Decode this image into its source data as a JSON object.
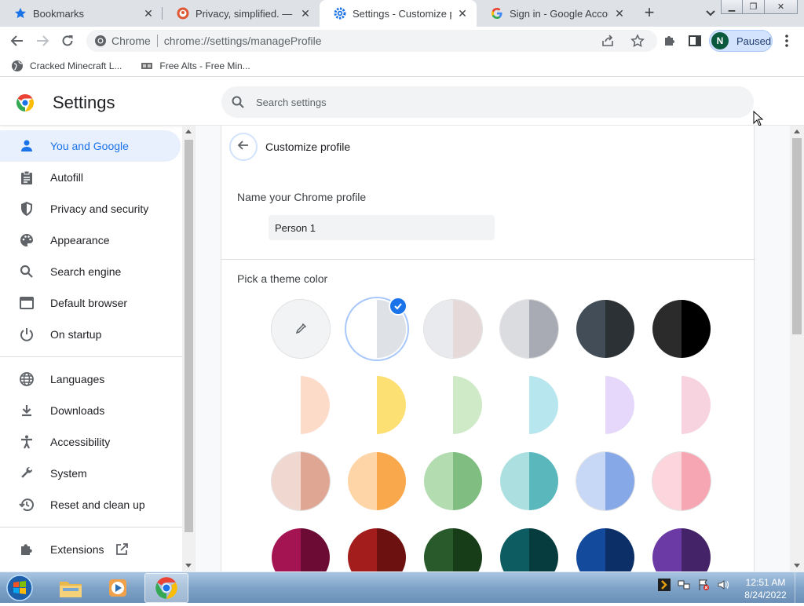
{
  "browser": {
    "tabs": [
      {
        "title": "Bookmarks",
        "icon": "star-icon"
      },
      {
        "title": "Privacy, simplified. — Duck",
        "icon": "duckduckgo-icon"
      },
      {
        "title": "Settings - Customize profile",
        "icon": "settings-gear-icon"
      },
      {
        "title": "Sign in - Google Accounts",
        "icon": "google-icon"
      }
    ],
    "active_tab_index": 2,
    "omnibox": {
      "site_label": "Chrome",
      "url": "chrome://settings/manageProfile"
    },
    "profile": {
      "initial": "N",
      "status": "Paused"
    },
    "bookmarks": [
      {
        "label": "Cracked Minecraft L...",
        "icon": "globe-icon"
      },
      {
        "label": "Free Alts - Free Min...",
        "icon": "alt-site-icon"
      }
    ]
  },
  "settings": {
    "title": "Settings",
    "search_placeholder": "Search settings",
    "nav": [
      {
        "label": "You and Google",
        "icon": "person-icon",
        "active": true
      },
      {
        "label": "Autofill",
        "icon": "clipboard-icon"
      },
      {
        "label": "Privacy and security",
        "icon": "shield-icon"
      },
      {
        "label": "Appearance",
        "icon": "palette-icon"
      },
      {
        "label": "Search engine",
        "icon": "search-icon"
      },
      {
        "label": "Default browser",
        "icon": "browser-window-icon"
      },
      {
        "label": "On startup",
        "icon": "power-icon"
      },
      {
        "label": "Languages",
        "icon": "globe-icon"
      },
      {
        "label": "Downloads",
        "icon": "download-icon"
      },
      {
        "label": "Accessibility",
        "icon": "accessibility-icon"
      },
      {
        "label": "System",
        "icon": "wrench-icon"
      },
      {
        "label": "Reset and clean up",
        "icon": "history-icon"
      },
      {
        "label": "Extensions",
        "icon": "puzzle-icon"
      }
    ],
    "page": {
      "title": "Customize profile",
      "name_label": "Name your Chrome profile",
      "name_value": "Person 1",
      "theme_label": "Pick a theme color",
      "swatches": [
        [
          "custom",
          "#f1f3f4",
          "selected:#dee1e6",
          "#e8eaed|#e5d9d9",
          "#dadce0|#a8abb3",
          "#434d57|#2c3136",
          "#2b2b2b|#000000"
        ],
        [
          "#fff|#fcdcc9",
          "#fff|#fde073",
          "#fff|#ceeac6",
          "#fff|#b7e6ef",
          "#fff|#e6d8fa",
          "#fff|#f6d3df"
        ],
        [
          "#f0d7cf|#e0a694",
          "#fdd5a6|#f9a84c",
          "#b4dcb1|#7fbd80",
          "#ace0e0|#5ab8bd",
          "#c7d8f6|#87a8e7",
          "#fdd5dc|#f6a6b3"
        ],
        [
          "#a41452|#6c0c34",
          "#a31d1d|#6d1010",
          "#285a2b|#173d18",
          "#0d5c61|#073c3f",
          "#134a9c|#0b2f66",
          "#6b3aa4|#452369"
        ]
      ]
    }
  },
  "taskbar": {
    "time": "12:51 AM",
    "date": "8/24/2022"
  }
}
